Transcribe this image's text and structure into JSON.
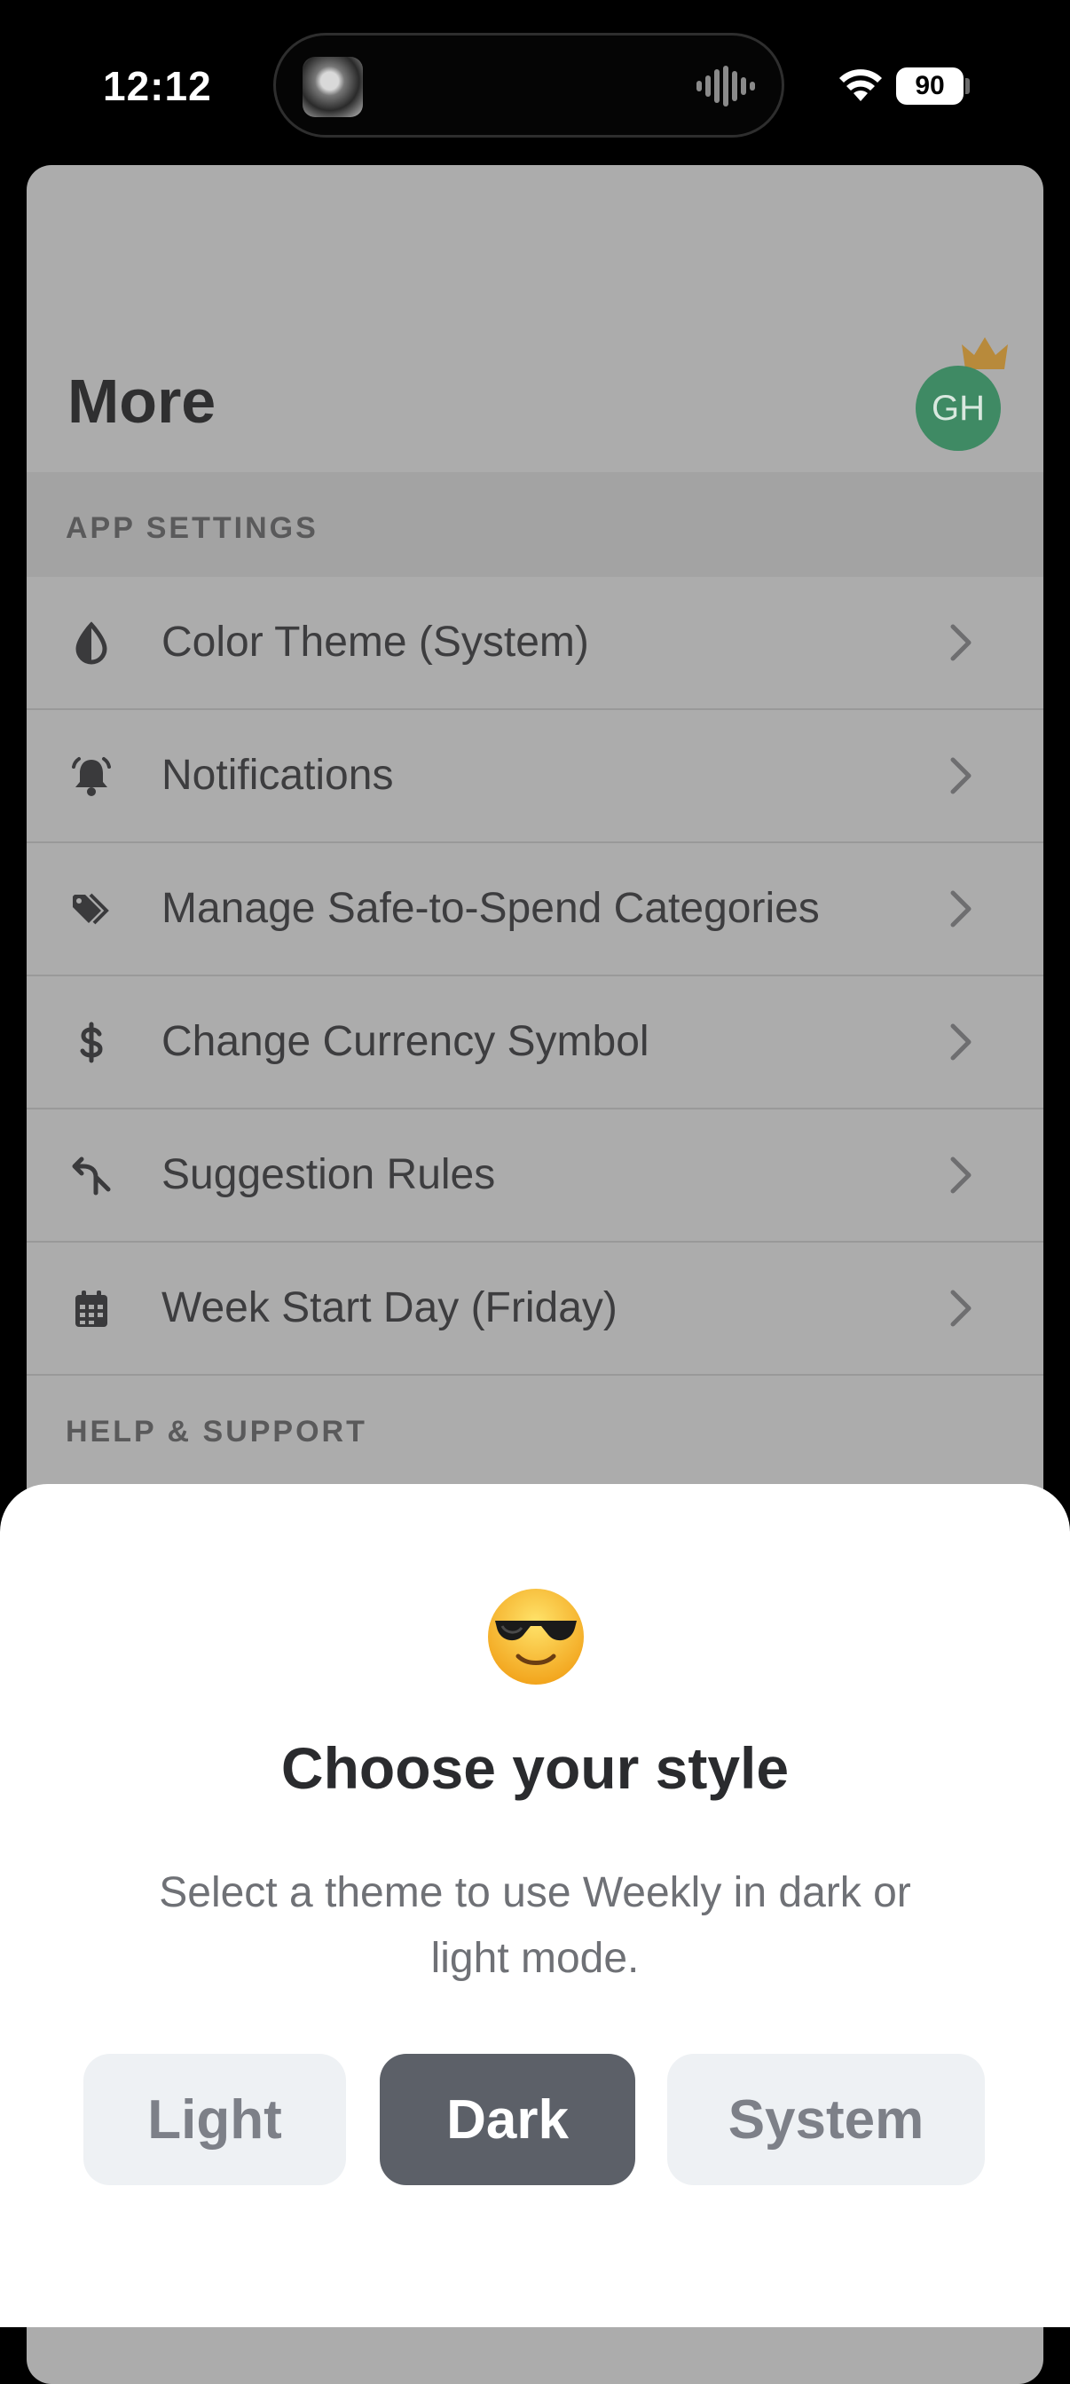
{
  "status_bar": {
    "time": "12:12",
    "battery": "90"
  },
  "page": {
    "title": "More",
    "avatar_initials": "GH",
    "accent_color": "#3f8a64"
  },
  "app_settings": {
    "header": "APP SETTINGS",
    "items": [
      {
        "label": "Color Theme (System)",
        "icon": "droplet-half-icon"
      },
      {
        "label": "Notifications",
        "icon": "bell-icon"
      },
      {
        "label": "Manage Safe-to-Spend Categories",
        "icon": "tags-icon"
      },
      {
        "label": "Change Currency Symbol",
        "icon": "dollar-icon"
      },
      {
        "label": "Suggestion Rules",
        "icon": "split-arrow-icon"
      },
      {
        "label": "Week Start Day (Friday)",
        "icon": "calendar-icon"
      }
    ]
  },
  "help_support": {
    "header": "HELP & SUPPORT"
  },
  "sheet": {
    "emoji": "sunglasses-face-icon",
    "title": "Choose your style",
    "subtitle": "Select a theme to use Weekly in dark or light mode.",
    "options": [
      "Light",
      "Dark",
      "System"
    ],
    "selected": "Dark"
  }
}
